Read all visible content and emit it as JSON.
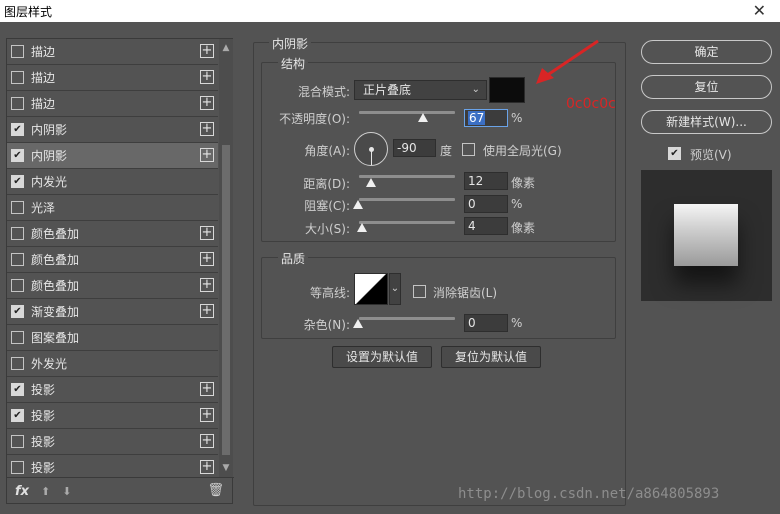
{
  "window": {
    "title": "图层样式",
    "close_glyph": "✕"
  },
  "style_list": [
    {
      "label": "描边",
      "checked": false,
      "has_plus": true,
      "selected": false
    },
    {
      "label": "描边",
      "checked": false,
      "has_plus": true,
      "selected": false
    },
    {
      "label": "描边",
      "checked": false,
      "has_plus": true,
      "selected": false
    },
    {
      "label": "内阴影",
      "checked": true,
      "has_plus": true,
      "selected": false
    },
    {
      "label": "内阴影",
      "checked": true,
      "has_plus": true,
      "selected": true
    },
    {
      "label": "内发光",
      "checked": true,
      "has_plus": false,
      "selected": false
    },
    {
      "label": "光泽",
      "checked": false,
      "has_plus": false,
      "selected": false
    },
    {
      "label": "颜色叠加",
      "checked": false,
      "has_plus": true,
      "selected": false
    },
    {
      "label": "颜色叠加",
      "checked": false,
      "has_plus": true,
      "selected": false
    },
    {
      "label": "颜色叠加",
      "checked": false,
      "has_plus": true,
      "selected": false
    },
    {
      "label": "渐变叠加",
      "checked": true,
      "has_plus": true,
      "selected": false
    },
    {
      "label": "图案叠加",
      "checked": false,
      "has_plus": false,
      "selected": false
    },
    {
      "label": "外发光",
      "checked": false,
      "has_plus": false,
      "selected": false
    },
    {
      "label": "投影",
      "checked": true,
      "has_plus": true,
      "selected": false
    },
    {
      "label": "投影",
      "checked": true,
      "has_plus": true,
      "selected": false
    },
    {
      "label": "投影",
      "checked": false,
      "has_plus": true,
      "selected": false
    },
    {
      "label": "投影",
      "checked": false,
      "has_plus": true,
      "selected": false
    }
  ],
  "list_toolbar": {
    "fx": "fx",
    "up_icon": "arrow-up-icon",
    "down_icon": "arrow-down-icon",
    "trash_icon": "trash-icon"
  },
  "panel": {
    "section_title": "内阴影",
    "structure": {
      "title": "结构",
      "blend_mode_label": "混合模式:",
      "blend_mode_value": "正片叠底",
      "shadow_color": "#0c0c0c",
      "opacity_label": "不透明度(O):",
      "opacity_value": "67",
      "opacity_level_pct": 67,
      "opacity_unit": "%",
      "angle_label": "角度(A):",
      "angle_value": "-90",
      "angle_unit": "度",
      "global_light_label": "使用全局光(G)",
      "global_light_checked": false,
      "distance_label": "距离(D):",
      "distance_value": "12",
      "distance_unit": "像素",
      "choke_label": "阻塞(C):",
      "choke_value": "0",
      "choke_unit": "%",
      "size_label": "大小(S):",
      "size_value": "4",
      "size_unit": "像素"
    },
    "quality": {
      "title": "品质",
      "contour_label": "等高线:",
      "anti_alias_label": "消除锯齿(L)",
      "anti_alias_checked": false,
      "noise_label": "杂色(N):",
      "noise_value": "0",
      "noise_unit": "%"
    },
    "buttons": {
      "set_default": "设置为默认值",
      "reset_default": "复位为默认值"
    }
  },
  "right": {
    "ok": "确定",
    "reset": "复位",
    "new_style": "新建样式(W)...",
    "preview_label": "预览(V)",
    "preview_checked": true
  },
  "annotation": {
    "text": "0c0c0c",
    "color": "#d82525"
  },
  "watermark": "http://blog.csdn.net/a864805893"
}
